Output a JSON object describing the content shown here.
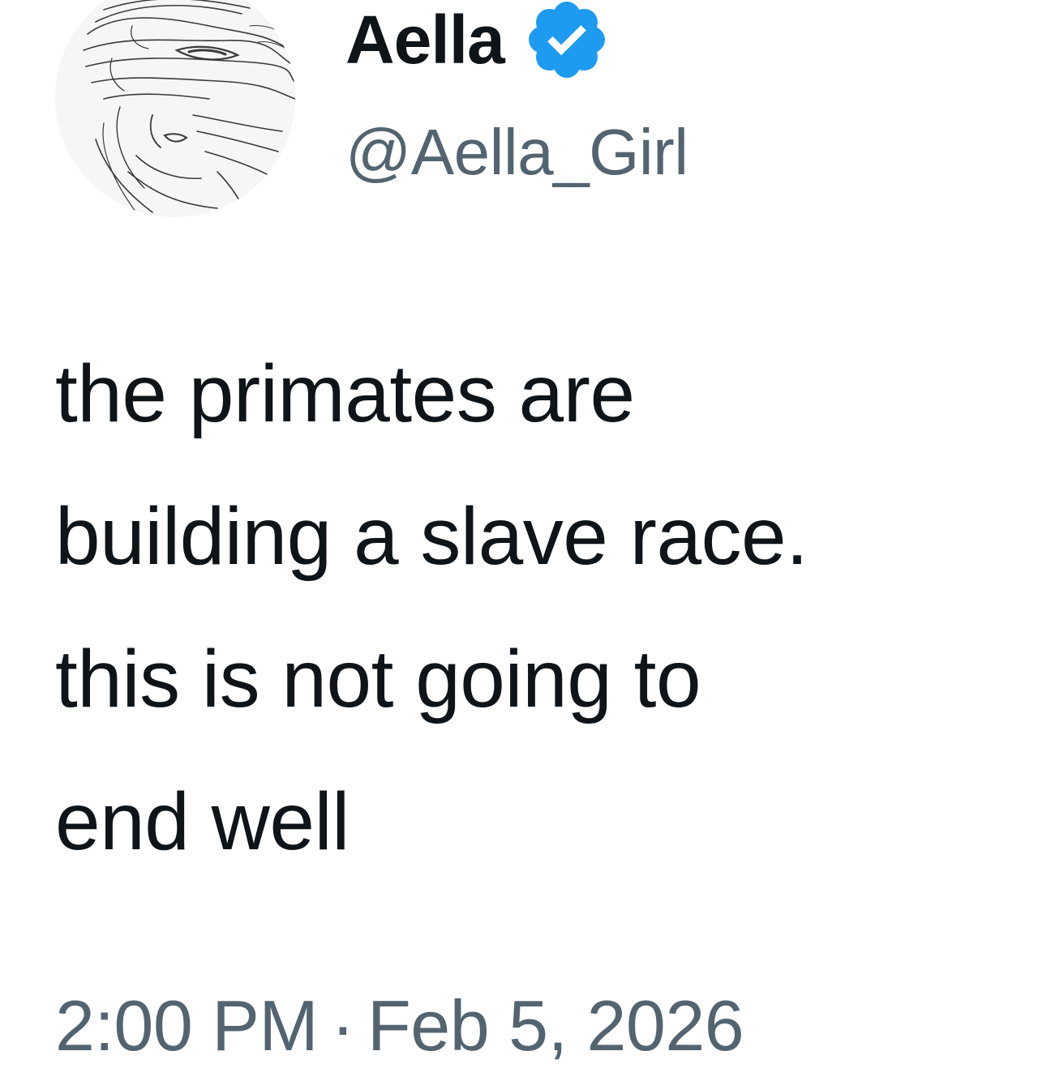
{
  "author": {
    "display_name": "Aella",
    "handle": "@Aella_Girl",
    "verified": true,
    "avatar_icon": "sketch-portrait-avatar",
    "verified_icon": "verified-badge-icon"
  },
  "tweet": {
    "lines": [
      "the primates are",
      "building a slave race.",
      "this is not going to",
      "end well"
    ]
  },
  "meta": {
    "time": "2:00 PM",
    "separator": "·",
    "date": "Feb 5, 2026"
  },
  "colors": {
    "text_primary": "#0f1419",
    "text_secondary": "#536471",
    "verified_blue": "#1d9bf0",
    "background": "#ffffff"
  }
}
